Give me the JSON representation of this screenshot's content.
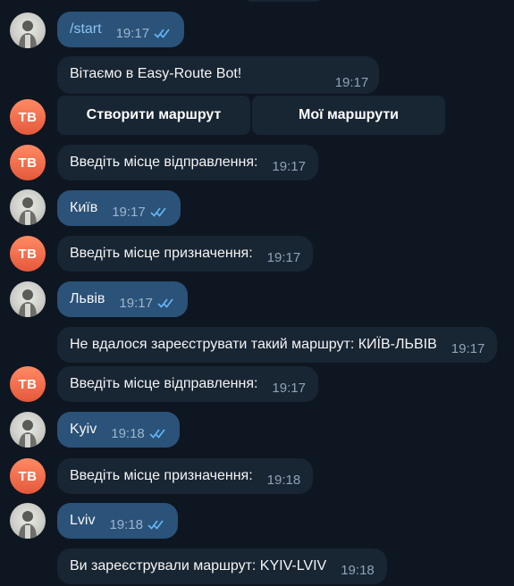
{
  "messages": {
    "m1": {
      "text": "/start",
      "time": "19:17"
    },
    "m2": {
      "text": "Вітаємо в Easy-Route Bot!",
      "time": "19:17"
    },
    "m3": {
      "text": "Введіть місце відправлення:",
      "time": "19:17"
    },
    "m4": {
      "text": "Київ",
      "time": "19:17"
    },
    "m5": {
      "text": "Введіть місце призначення:",
      "time": "19:17"
    },
    "m6": {
      "text": "Львів",
      "time": "19:17"
    },
    "m7": {
      "text": "Не вдалося зареєструвати такий маршрут: КИЇВ-ЛЬВІВ",
      "time": "19:17"
    },
    "m8": {
      "text": "Введіть місце відправлення:",
      "time": "19:17"
    },
    "m9": {
      "text": "Kyiv",
      "time": "19:18"
    },
    "m10": {
      "text": "Введіть місце призначення:",
      "time": "19:18"
    },
    "m11": {
      "text": "Lviv",
      "time": "19:18"
    },
    "m12": {
      "text": "Ви зареєстрували маршрут: KYIV-LVIV",
      "time": "19:18"
    }
  },
  "keyboard": {
    "create_route": "Створити маршрут",
    "my_routes": "Мої маршрути"
  },
  "bot_avatar_initials": "TB",
  "icons": {
    "read_ticks": "double-check-icon",
    "user_avatar": "user-photo-icon"
  },
  "colors": {
    "background": "#0e1621",
    "outgoing_bubble": "#2b5278",
    "incoming_bubble": "#182533",
    "bot_avatar": "#e5583b",
    "ticks": "#64b5f6"
  }
}
